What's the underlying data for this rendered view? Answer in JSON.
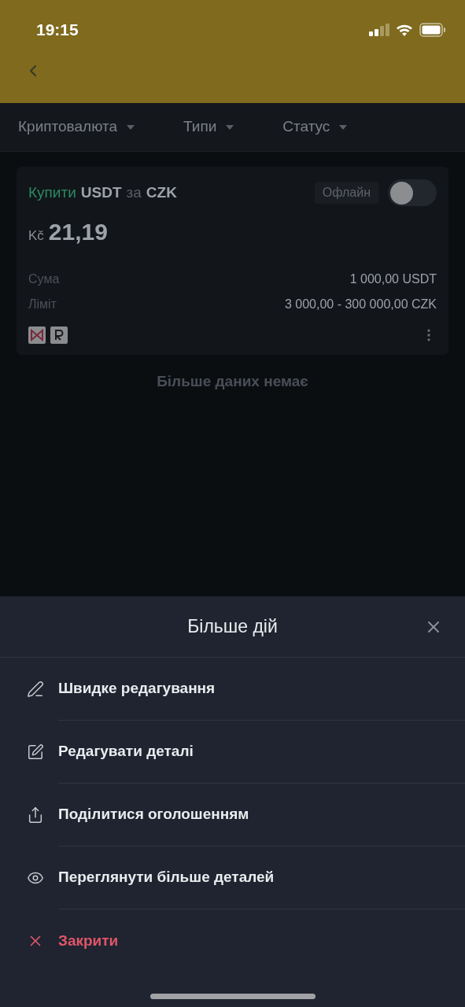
{
  "status_bar": {
    "time": "19:15"
  },
  "filters": [
    {
      "label": "Криптовалюта"
    },
    {
      "label": "Типи"
    },
    {
      "label": "Статус"
    }
  ],
  "ad_card": {
    "side": "Купити",
    "asset": "USDT",
    "connector": "за",
    "fiat": "CZK",
    "status_badge": "Офлайн",
    "online": false,
    "currency_symbol": "Kč",
    "price": "21,19",
    "rows": [
      {
        "label": "Сума",
        "value": "1 000,00 USDT"
      },
      {
        "label": "Ліміт",
        "value": "3 000,00 - 300 000,00 CZK"
      }
    ]
  },
  "end_message": "Більше даних немає",
  "sheet": {
    "title": "Більше дій",
    "items": [
      {
        "kind": "quick-edit",
        "label": "Швидке редагування"
      },
      {
        "kind": "edit",
        "label": "Редагувати деталі"
      },
      {
        "kind": "share",
        "label": "Поділитися оголошенням"
      },
      {
        "kind": "view",
        "label": "Переглянути більше деталей"
      },
      {
        "kind": "close",
        "label": "Закрити"
      }
    ]
  }
}
